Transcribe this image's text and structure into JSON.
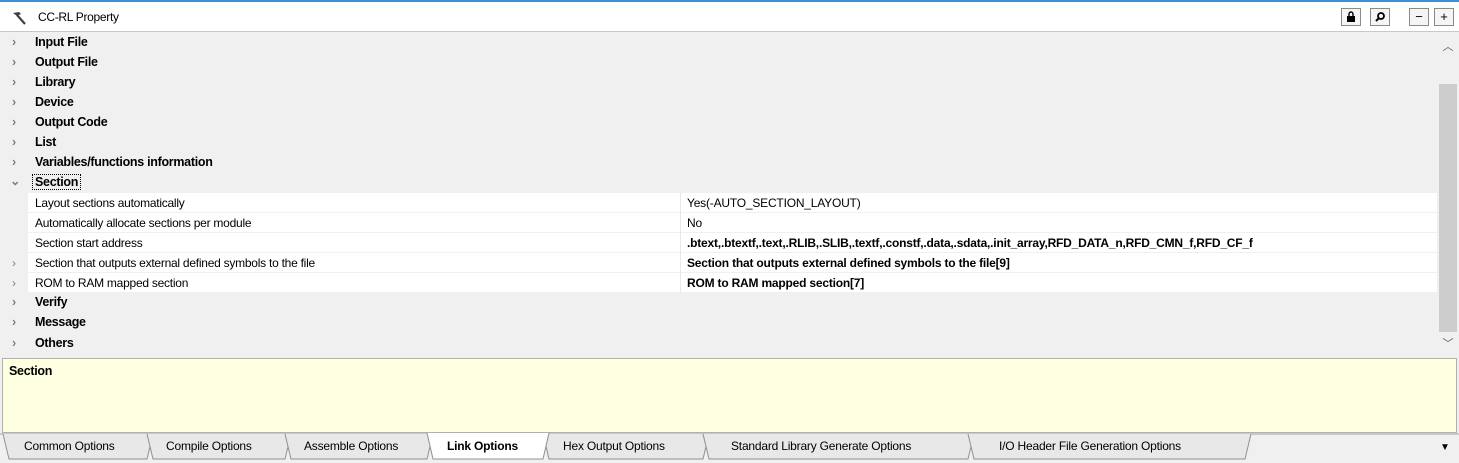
{
  "window": {
    "title": "CC-RL Property",
    "icon": "hammer-icon",
    "buttons": [
      {
        "name": "lock-icon",
        "glyph": "🔒"
      },
      {
        "name": "search-icon",
        "glyph": "⚲"
      },
      {
        "name": "minus-button",
        "glyph": "−"
      },
      {
        "name": "plus-button",
        "glyph": "+"
      }
    ]
  },
  "categories_top": [
    {
      "label": "Input File",
      "expanded": false
    },
    {
      "label": "Output File",
      "expanded": false
    },
    {
      "label": "Library",
      "expanded": false
    },
    {
      "label": "Device",
      "expanded": false
    },
    {
      "label": "Output Code",
      "expanded": false
    },
    {
      "label": "List",
      "expanded": false
    },
    {
      "label": "Variables/functions information",
      "expanded": false
    }
  ],
  "section": {
    "label": "Section",
    "expanded": true,
    "properties": [
      {
        "name": "Layout sections automatically",
        "value": "Yes(-AUTO_SECTION_LAYOUT)",
        "bold": false,
        "expandable": false
      },
      {
        "name": "Automatically allocate sections per module",
        "value": "No",
        "bold": false,
        "expandable": false
      },
      {
        "name": "Section start address",
        "value": ".btext,.btextf,.text,.RLIB,.SLIB,.textf,.constf,.data,.sdata,.init_array,RFD_DATA_n,RFD_CMN_f,RFD_CF_f",
        "bold": true,
        "expandable": false
      },
      {
        "name": "Section that outputs external defined symbols to the file",
        "value": "Section that outputs external defined symbols to the file[9]",
        "bold": true,
        "expandable": true
      },
      {
        "name": "ROM to RAM mapped section",
        "value": "ROM to RAM mapped section[7]",
        "bold": true,
        "expandable": true
      }
    ]
  },
  "categories_bottom": [
    {
      "label": "Verify",
      "expanded": false
    },
    {
      "label": "Message",
      "expanded": false
    },
    {
      "label": "Others",
      "expanded": false
    }
  ],
  "description": {
    "title": "Section"
  },
  "tabs": [
    {
      "label": "Common Options",
      "active": false
    },
    {
      "label": "Compile Options",
      "active": false
    },
    {
      "label": "Assemble Options",
      "active": false
    },
    {
      "label": "Link Options",
      "active": true
    },
    {
      "label": "Hex Output Options",
      "active": false
    },
    {
      "label": "Standard Library Generate Options",
      "active": false
    },
    {
      "label": "I/O Header File Generation Options",
      "active": false
    }
  ]
}
